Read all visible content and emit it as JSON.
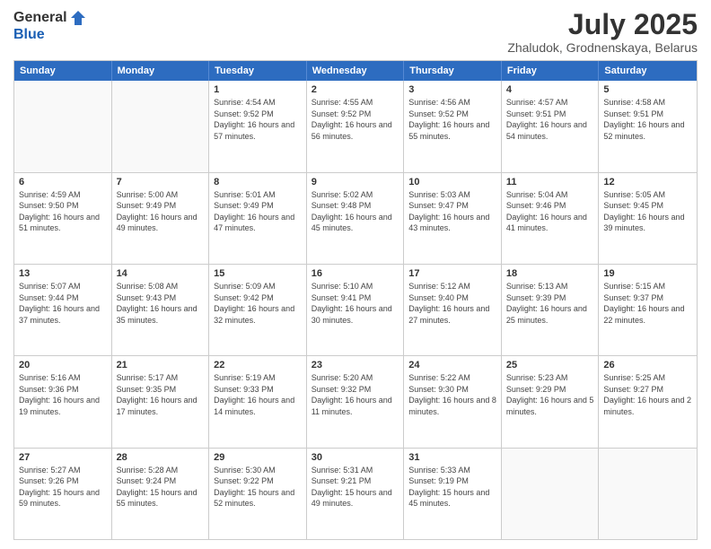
{
  "logo": {
    "general": "General",
    "blue": "Blue"
  },
  "title": "July 2025",
  "subtitle": "Zhaludok, Grodnenskaya, Belarus",
  "header_days": [
    "Sunday",
    "Monday",
    "Tuesday",
    "Wednesday",
    "Thursday",
    "Friday",
    "Saturday"
  ],
  "weeks": [
    [
      {
        "day": "",
        "sunrise": "",
        "sunset": "",
        "daylight": "",
        "empty": true
      },
      {
        "day": "",
        "sunrise": "",
        "sunset": "",
        "daylight": "",
        "empty": true
      },
      {
        "day": "1",
        "sunrise": "Sunrise: 4:54 AM",
        "sunset": "Sunset: 9:52 PM",
        "daylight": "Daylight: 16 hours and 57 minutes.",
        "empty": false
      },
      {
        "day": "2",
        "sunrise": "Sunrise: 4:55 AM",
        "sunset": "Sunset: 9:52 PM",
        "daylight": "Daylight: 16 hours and 56 minutes.",
        "empty": false
      },
      {
        "day": "3",
        "sunrise": "Sunrise: 4:56 AM",
        "sunset": "Sunset: 9:52 PM",
        "daylight": "Daylight: 16 hours and 55 minutes.",
        "empty": false
      },
      {
        "day": "4",
        "sunrise": "Sunrise: 4:57 AM",
        "sunset": "Sunset: 9:51 PM",
        "daylight": "Daylight: 16 hours and 54 minutes.",
        "empty": false
      },
      {
        "day": "5",
        "sunrise": "Sunrise: 4:58 AM",
        "sunset": "Sunset: 9:51 PM",
        "daylight": "Daylight: 16 hours and 52 minutes.",
        "empty": false
      }
    ],
    [
      {
        "day": "6",
        "sunrise": "Sunrise: 4:59 AM",
        "sunset": "Sunset: 9:50 PM",
        "daylight": "Daylight: 16 hours and 51 minutes.",
        "empty": false
      },
      {
        "day": "7",
        "sunrise": "Sunrise: 5:00 AM",
        "sunset": "Sunset: 9:49 PM",
        "daylight": "Daylight: 16 hours and 49 minutes.",
        "empty": false
      },
      {
        "day": "8",
        "sunrise": "Sunrise: 5:01 AM",
        "sunset": "Sunset: 9:49 PM",
        "daylight": "Daylight: 16 hours and 47 minutes.",
        "empty": false
      },
      {
        "day": "9",
        "sunrise": "Sunrise: 5:02 AM",
        "sunset": "Sunset: 9:48 PM",
        "daylight": "Daylight: 16 hours and 45 minutes.",
        "empty": false
      },
      {
        "day": "10",
        "sunrise": "Sunrise: 5:03 AM",
        "sunset": "Sunset: 9:47 PM",
        "daylight": "Daylight: 16 hours and 43 minutes.",
        "empty": false
      },
      {
        "day": "11",
        "sunrise": "Sunrise: 5:04 AM",
        "sunset": "Sunset: 9:46 PM",
        "daylight": "Daylight: 16 hours and 41 minutes.",
        "empty": false
      },
      {
        "day": "12",
        "sunrise": "Sunrise: 5:05 AM",
        "sunset": "Sunset: 9:45 PM",
        "daylight": "Daylight: 16 hours and 39 minutes.",
        "empty": false
      }
    ],
    [
      {
        "day": "13",
        "sunrise": "Sunrise: 5:07 AM",
        "sunset": "Sunset: 9:44 PM",
        "daylight": "Daylight: 16 hours and 37 minutes.",
        "empty": false
      },
      {
        "day": "14",
        "sunrise": "Sunrise: 5:08 AM",
        "sunset": "Sunset: 9:43 PM",
        "daylight": "Daylight: 16 hours and 35 minutes.",
        "empty": false
      },
      {
        "day": "15",
        "sunrise": "Sunrise: 5:09 AM",
        "sunset": "Sunset: 9:42 PM",
        "daylight": "Daylight: 16 hours and 32 minutes.",
        "empty": false
      },
      {
        "day": "16",
        "sunrise": "Sunrise: 5:10 AM",
        "sunset": "Sunset: 9:41 PM",
        "daylight": "Daylight: 16 hours and 30 minutes.",
        "empty": false
      },
      {
        "day": "17",
        "sunrise": "Sunrise: 5:12 AM",
        "sunset": "Sunset: 9:40 PM",
        "daylight": "Daylight: 16 hours and 27 minutes.",
        "empty": false
      },
      {
        "day": "18",
        "sunrise": "Sunrise: 5:13 AM",
        "sunset": "Sunset: 9:39 PM",
        "daylight": "Daylight: 16 hours and 25 minutes.",
        "empty": false
      },
      {
        "day": "19",
        "sunrise": "Sunrise: 5:15 AM",
        "sunset": "Sunset: 9:37 PM",
        "daylight": "Daylight: 16 hours and 22 minutes.",
        "empty": false
      }
    ],
    [
      {
        "day": "20",
        "sunrise": "Sunrise: 5:16 AM",
        "sunset": "Sunset: 9:36 PM",
        "daylight": "Daylight: 16 hours and 19 minutes.",
        "empty": false
      },
      {
        "day": "21",
        "sunrise": "Sunrise: 5:17 AM",
        "sunset": "Sunset: 9:35 PM",
        "daylight": "Daylight: 16 hours and 17 minutes.",
        "empty": false
      },
      {
        "day": "22",
        "sunrise": "Sunrise: 5:19 AM",
        "sunset": "Sunset: 9:33 PM",
        "daylight": "Daylight: 16 hours and 14 minutes.",
        "empty": false
      },
      {
        "day": "23",
        "sunrise": "Sunrise: 5:20 AM",
        "sunset": "Sunset: 9:32 PM",
        "daylight": "Daylight: 16 hours and 11 minutes.",
        "empty": false
      },
      {
        "day": "24",
        "sunrise": "Sunrise: 5:22 AM",
        "sunset": "Sunset: 9:30 PM",
        "daylight": "Daylight: 16 hours and 8 minutes.",
        "empty": false
      },
      {
        "day": "25",
        "sunrise": "Sunrise: 5:23 AM",
        "sunset": "Sunset: 9:29 PM",
        "daylight": "Daylight: 16 hours and 5 minutes.",
        "empty": false
      },
      {
        "day": "26",
        "sunrise": "Sunrise: 5:25 AM",
        "sunset": "Sunset: 9:27 PM",
        "daylight": "Daylight: 16 hours and 2 minutes.",
        "empty": false
      }
    ],
    [
      {
        "day": "27",
        "sunrise": "Sunrise: 5:27 AM",
        "sunset": "Sunset: 9:26 PM",
        "daylight": "Daylight: 15 hours and 59 minutes.",
        "empty": false
      },
      {
        "day": "28",
        "sunrise": "Sunrise: 5:28 AM",
        "sunset": "Sunset: 9:24 PM",
        "daylight": "Daylight: 15 hours and 55 minutes.",
        "empty": false
      },
      {
        "day": "29",
        "sunrise": "Sunrise: 5:30 AM",
        "sunset": "Sunset: 9:22 PM",
        "daylight": "Daylight: 15 hours and 52 minutes.",
        "empty": false
      },
      {
        "day": "30",
        "sunrise": "Sunrise: 5:31 AM",
        "sunset": "Sunset: 9:21 PM",
        "daylight": "Daylight: 15 hours and 49 minutes.",
        "empty": false
      },
      {
        "day": "31",
        "sunrise": "Sunrise: 5:33 AM",
        "sunset": "Sunset: 9:19 PM",
        "daylight": "Daylight: 15 hours and 45 minutes.",
        "empty": false
      },
      {
        "day": "",
        "sunrise": "",
        "sunset": "",
        "daylight": "",
        "empty": true
      },
      {
        "day": "",
        "sunrise": "",
        "sunset": "",
        "daylight": "",
        "empty": true
      }
    ]
  ]
}
